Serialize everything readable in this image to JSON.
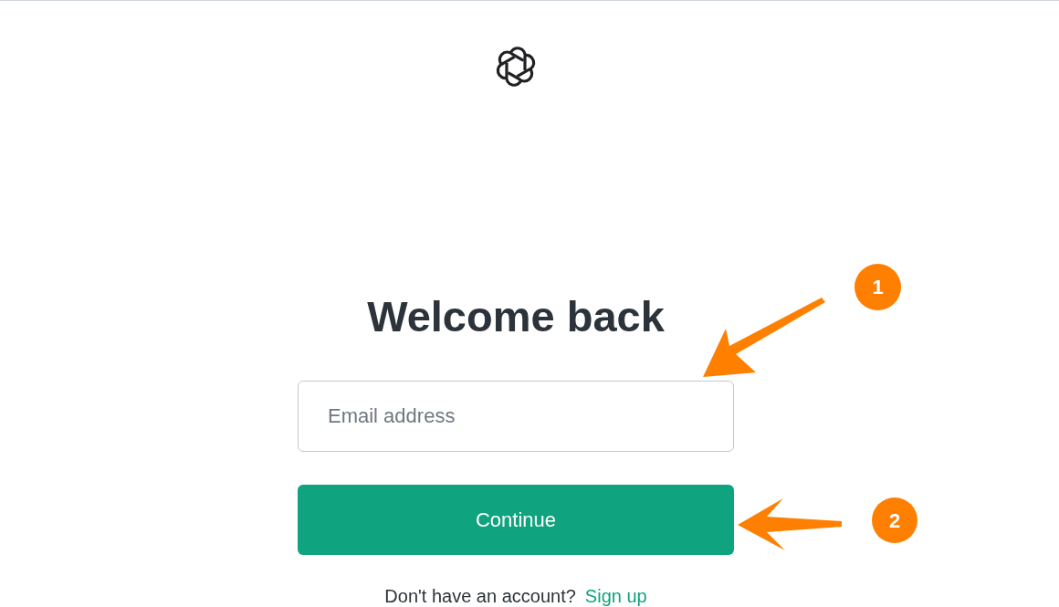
{
  "heading": "Welcome back",
  "email_field": {
    "placeholder": "Email address"
  },
  "continue_button": "Continue",
  "footer": {
    "text": "Don't have an account?",
    "link": "Sign up"
  },
  "annotations": [
    {
      "number": "1"
    },
    {
      "number": "2"
    }
  ]
}
